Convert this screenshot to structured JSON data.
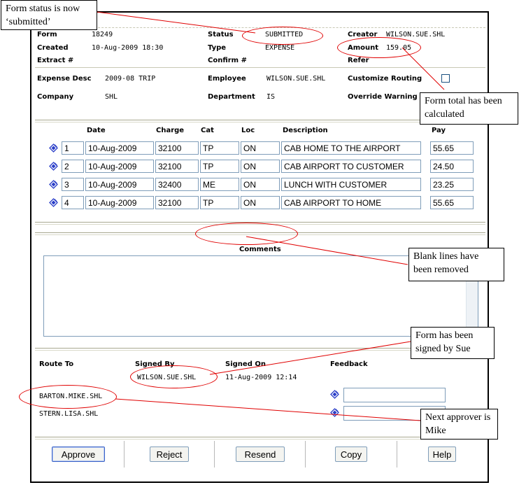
{
  "header": {
    "form_label": "Form",
    "form_value": "18249",
    "created_label": "Created",
    "created_value": "10-Aug-2009 18:30",
    "extract_label": "Extract #",
    "status_label": "Status",
    "status_value": "SUBMITTED",
    "type_label": "Type",
    "type_value": "EXPENSE",
    "confirm_label": "Confirm #",
    "creator_label": "Creator",
    "creator_value": "WILSON.SUE.SHL",
    "amount_label": "Amount",
    "amount_value": "159.05",
    "refer_label": "Refer"
  },
  "details": {
    "expense_desc_label": "Expense Desc",
    "expense_desc_value": "2009-08 TRIP",
    "company_label": "Company",
    "company_value": "SHL",
    "employee_label": "Employee",
    "employee_value": "WILSON.SUE.SHL",
    "department_label": "Department",
    "department_value": "IS",
    "customize_routing_label": "Customize Routing",
    "override_warning_label": "Override Warning"
  },
  "lines": {
    "columns": {
      "date": "Date",
      "charge": "Charge",
      "cat": "Cat",
      "loc": "Loc",
      "description": "Description",
      "pay": "Pay"
    },
    "rows": [
      {
        "num": "1",
        "date": "10-Aug-2009",
        "charge": "32100",
        "cat": "TP",
        "loc": "ON",
        "description": "CAB HOME TO THE AIRPORT",
        "pay": "55.65"
      },
      {
        "num": "2",
        "date": "10-Aug-2009",
        "charge": "32100",
        "cat": "TP",
        "loc": "ON",
        "description": "CAB AIRPORT TO CUSTOMER",
        "pay": "24.50"
      },
      {
        "num": "3",
        "date": "10-Aug-2009",
        "charge": "32400",
        "cat": "ME",
        "loc": "ON",
        "description": "LUNCH WITH CUSTOMER",
        "pay": "23.25"
      },
      {
        "num": "4",
        "date": "10-Aug-2009",
        "charge": "32100",
        "cat": "TP",
        "loc": "ON",
        "description": "CAB AIRPORT TO HOME",
        "pay": "55.65"
      }
    ]
  },
  "comments": {
    "label": "Comments",
    "value": ""
  },
  "routing": {
    "route_to_label": "Route To",
    "signed_by_label": "Signed By",
    "signed_on_label": "Signed On",
    "feedback_label": "Feedback",
    "signed_by_value": "WILSON.SUE.SHL",
    "signed_on_value": "11-Aug-2009 12:14",
    "route_1": "BARTON.MIKE.SHL",
    "route_2": "STERN.LISA.SHL"
  },
  "buttons": {
    "approve": "Approve",
    "reject": "Reject",
    "resend": "Resend",
    "copy": "Copy",
    "help": "Help"
  },
  "callouts": {
    "status": "Form status is now ‘submitted’",
    "total": "Form total has been calculated",
    "blank": "Blank lines have been removed",
    "signed": "Form has been signed by Sue",
    "next": "Next approver is Mike"
  },
  "colors": {
    "annotation": "#e00000",
    "input_border": "#7f9db9",
    "icon_blue": "#2a3ec8"
  },
  "icons": {
    "row_icon": "edit-row-icon",
    "feedback_icon": "feedback-icon"
  }
}
